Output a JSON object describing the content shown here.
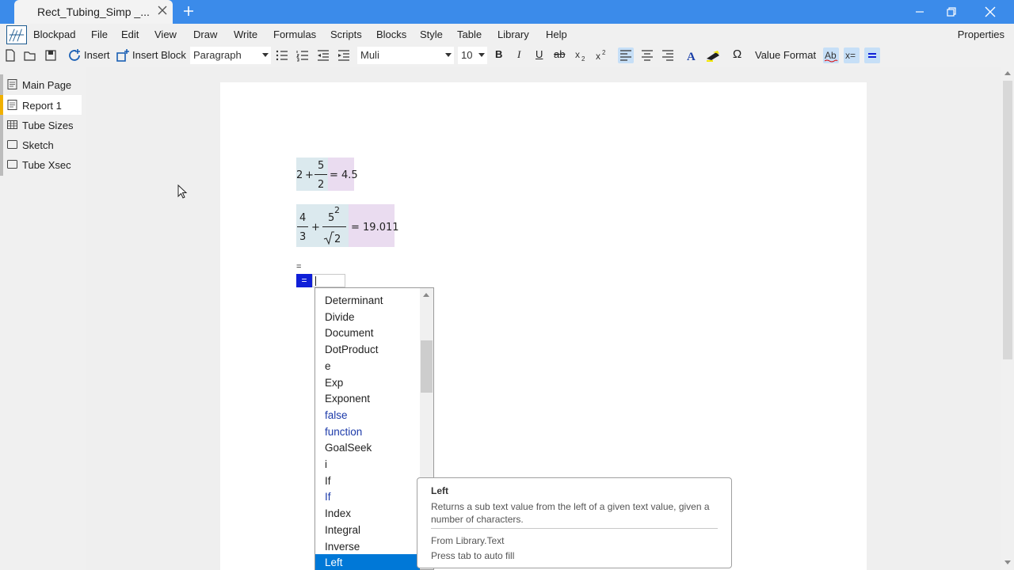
{
  "window": {
    "tab_title": "Rect_Tubing_Simp _...",
    "accent": "#3b8bea"
  },
  "menubar": {
    "app_name": "Blockpad",
    "items": [
      "File",
      "Edit",
      "View",
      "Draw",
      "Write",
      "Formulas",
      "Scripts",
      "Blocks",
      "Style",
      "Table",
      "Library",
      "Help"
    ],
    "properties": "Properties"
  },
  "toolbar": {
    "insert": "Insert",
    "insert_block": "Insert Block",
    "paragraph_style": "Paragraph",
    "font": "Muli",
    "font_size": "10",
    "value_format": "Value Format",
    "bold": "B",
    "italic": "I",
    "underline": "U",
    "strike": "ab",
    "omega": "Ω"
  },
  "sidebar": {
    "items": [
      {
        "label": "Main Page",
        "icon": "page-icon"
      },
      {
        "label": "Report 1",
        "icon": "page-icon",
        "active": true
      },
      {
        "label": "Tube Sizes",
        "icon": "table-icon"
      },
      {
        "label": "Sketch",
        "icon": "drawing-icon"
      },
      {
        "label": "Tube Xsec",
        "icon": "drawing-icon"
      }
    ]
  },
  "equations": {
    "eq1": {
      "whole": "2",
      "plus": "+",
      "num": "5",
      "den": "2",
      "result": "= 4.5"
    },
    "eq2": {
      "num1": "4",
      "den1": "3",
      "plus": "+",
      "num2": "5",
      "exp": "2",
      "sqrt_arg": "2",
      "result": "= 19.011"
    },
    "eq3": {
      "mark": "=",
      "button": "="
    }
  },
  "autocomplete": {
    "items": [
      {
        "label": "Determinant"
      },
      {
        "label": "Divide"
      },
      {
        "label": "Document"
      },
      {
        "label": "DotProduct"
      },
      {
        "label": "e"
      },
      {
        "label": "Exp"
      },
      {
        "label": "Exponent"
      },
      {
        "label": "false",
        "keyword": true
      },
      {
        "label": "function",
        "keyword": true
      },
      {
        "label": "GoalSeek"
      },
      {
        "label": "i"
      },
      {
        "label": "If"
      },
      {
        "label": "If",
        "keyword": true
      },
      {
        "label": "Index"
      },
      {
        "label": "Integral"
      },
      {
        "label": "Inverse"
      },
      {
        "label": "Left",
        "selected": true
      }
    ]
  },
  "tooltip": {
    "title": "Left",
    "description": "Returns a sub text value from the left of a given text value, given a number of characters.",
    "from": "From Library.Text",
    "hint": "Press tab to auto fill"
  }
}
